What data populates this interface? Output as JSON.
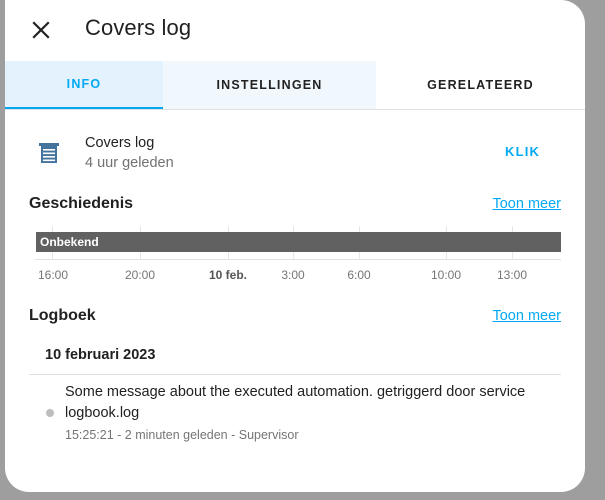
{
  "dialog": {
    "title": "Covers log"
  },
  "tabs": [
    {
      "label": "INFO",
      "active": true
    },
    {
      "label": "INSTELLINGEN",
      "active": false
    },
    {
      "label": "GERELATEERD",
      "active": false
    }
  ],
  "entity": {
    "icon": "window-shutter-icon",
    "name": "Covers log",
    "last_changed": "4 uur geleden",
    "action_label": "KLIK"
  },
  "history": {
    "title": "Geschiedenis",
    "more_label": "Toon meer",
    "state_label": "Onbekend",
    "ticks": [
      "16:00",
      "20:00",
      "10 feb.",
      "3:00",
      "6:00",
      "10:00",
      "13:00"
    ]
  },
  "logbook": {
    "title": "Logboek",
    "more_label": "Toon meer",
    "date_heading": "10 februari 2023",
    "entries": [
      {
        "message": "Some message about the executed automation. getriggerd door service logbook.log",
        "meta": "15:25:21 - 2 minuten geleden - Supervisor"
      }
    ]
  },
  "colors": {
    "accent": "#03a9f4",
    "active_tab_bg": "#e3f2fd",
    "timeline_bar": "#616161"
  }
}
